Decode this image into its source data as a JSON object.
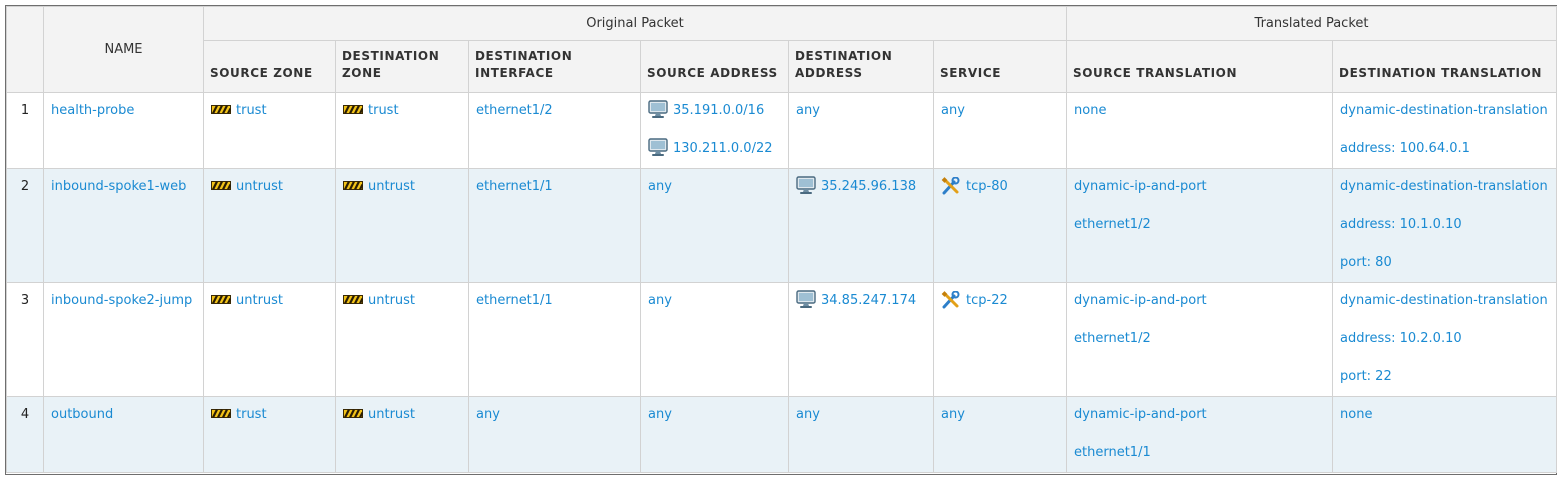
{
  "header": {
    "original_packet": "Original Packet",
    "translated_packet": "Translated Packet",
    "columns": {
      "name": "NAME",
      "source_zone": "SOURCE ZONE",
      "destination_zone": "DESTINATION ZONE",
      "destination_interface": "DESTINATION INTERFACE",
      "source_address": "SOURCE ADDRESS",
      "destination_address": "DESTINATION ADDRESS",
      "service": "SERVICE",
      "source_translation": "SOURCE TRANSLATION",
      "destination_translation": "DESTINATION TRANSLATION"
    }
  },
  "icons": {
    "zone": "zone-barrier-icon",
    "address": "address-monitor-icon",
    "service": "service-tools-icon"
  },
  "colors": {
    "link": "#1a8ad2",
    "row_alt": "#e9f2f7",
    "header_bg": "#f3f3f3"
  },
  "rows": [
    {
      "num": "1",
      "name": "health-probe",
      "source_zone": "trust",
      "destination_zone": "trust",
      "destination_interface": "ethernet1/2",
      "source_address": [
        "35.191.0.0/16",
        "130.211.0.0/22"
      ],
      "destination_address": "any",
      "service": "any",
      "source_translation": [
        "none"
      ],
      "destination_translation": [
        "dynamic-destination-translation",
        "address: 100.64.0.1"
      ]
    },
    {
      "num": "2",
      "name": "inbound-spoke1-web",
      "source_zone": "untrust",
      "destination_zone": "untrust",
      "destination_interface": "ethernet1/1",
      "source_address": [
        "any"
      ],
      "destination_address": "35.245.96.138",
      "service": "tcp-80",
      "source_translation": [
        "dynamic-ip-and-port",
        "ethernet1/2"
      ],
      "destination_translation": [
        "dynamic-destination-translation",
        "address: 10.1.0.10",
        "port: 80"
      ]
    },
    {
      "num": "3",
      "name": "inbound-spoke2-jump",
      "source_zone": "untrust",
      "destination_zone": "untrust",
      "destination_interface": "ethernet1/1",
      "source_address": [
        "any"
      ],
      "destination_address": "34.85.247.174",
      "service": "tcp-22",
      "source_translation": [
        "dynamic-ip-and-port",
        "ethernet1/2"
      ],
      "destination_translation": [
        "dynamic-destination-translation",
        "address: 10.2.0.10",
        "port: 22"
      ]
    },
    {
      "num": "4",
      "name": "outbound",
      "source_zone": "trust",
      "destination_zone": "untrust",
      "destination_interface": "any",
      "source_address": [
        "any"
      ],
      "destination_address": "any",
      "service": "any",
      "source_translation": [
        "dynamic-ip-and-port",
        "ethernet1/1"
      ],
      "destination_translation": [
        "none"
      ]
    }
  ]
}
